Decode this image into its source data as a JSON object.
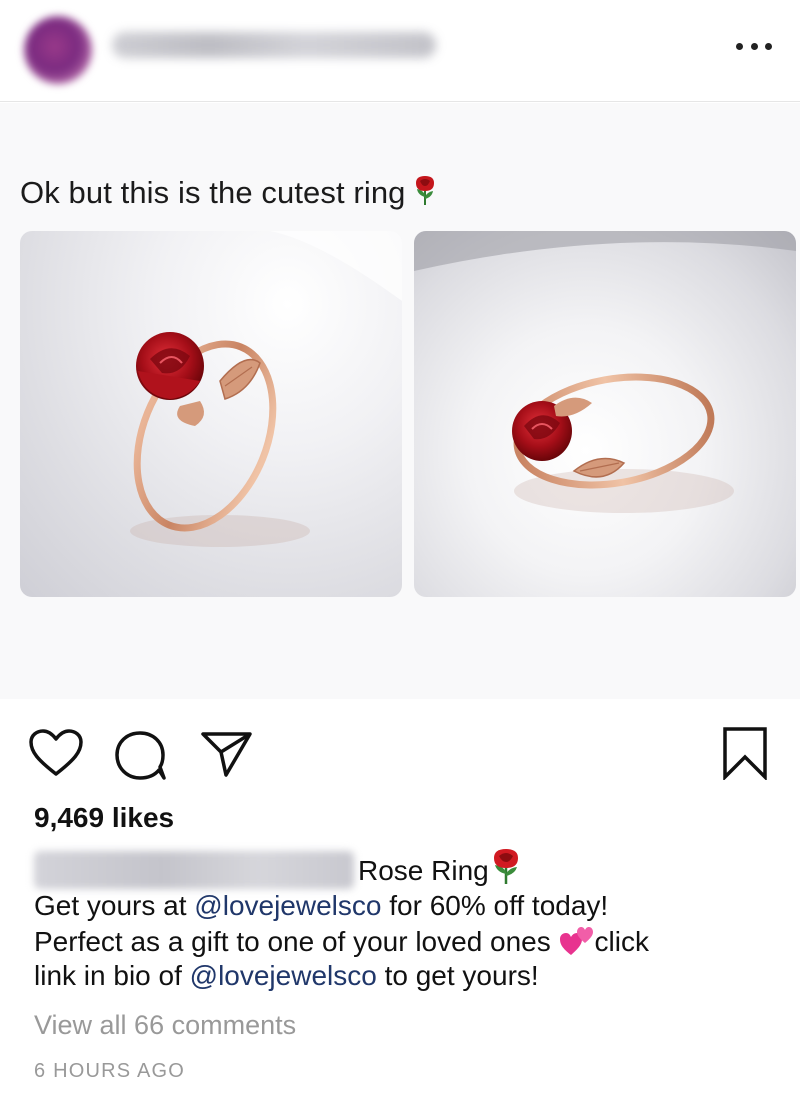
{
  "header": {
    "avatar_icon": "profile-avatar-blurred",
    "username": "",
    "more_icon": "more-horizontal-icon"
  },
  "post": {
    "image_caption": "Ok but this is the cutest ring",
    "image_caption_emoji": "rose-emoji"
  },
  "actions": {
    "like_icon": "heart-icon",
    "comment_icon": "comment-icon",
    "share_icon": "paper-plane-icon",
    "save_icon": "bookmark-icon"
  },
  "likes": "9,469 likes",
  "caption": {
    "title": "Rose Ring",
    "line1_prefix": "Get yours at ",
    "mention1": "@lovejewelsco",
    "line1_suffix": " for 60% off today!",
    "line2_prefix": "Perfect as a gift to one of your loved ones ",
    "line2_suffix": "click",
    "line3_prefix": "link in bio of ",
    "mention2": "@lovejewelsco",
    "line3_suffix": " to get yours!"
  },
  "view_all_comments": "View all 66 comments",
  "timestamp": "6 HOURS AGO",
  "colors": {
    "mention": "#20376a",
    "muted": "#999999",
    "rose_red": "#c4161c"
  }
}
